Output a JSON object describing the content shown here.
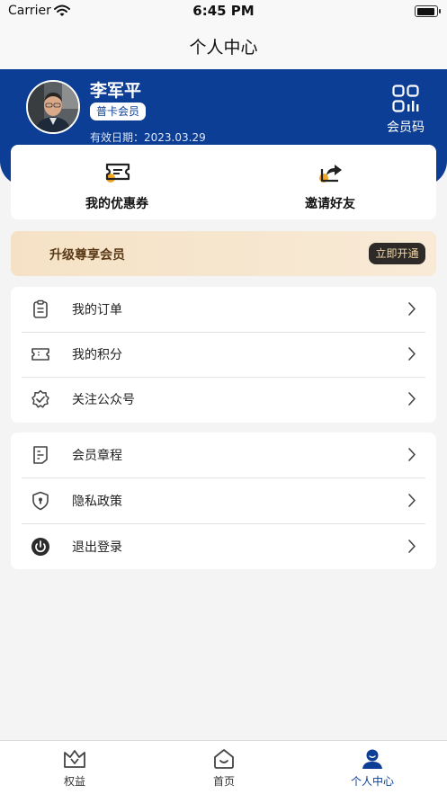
{
  "status_bar": {
    "carrier": "Carrier",
    "time": "6:45 PM"
  },
  "nav": {
    "title": "个人中心"
  },
  "profile": {
    "name": "李军平",
    "level": "普卡会员",
    "expiry_label": "有效日期：",
    "expiry_date": "2023.03.29",
    "qr_label": "会员码"
  },
  "actions": [
    {
      "label": "我的优惠券",
      "icon": "coupon-icon"
    },
    {
      "label": "邀请好友",
      "icon": "share-icon"
    }
  ],
  "vip_banner": {
    "title": "升级尊享会员",
    "button": "立即开通"
  },
  "menu_group_1": [
    {
      "label": "我的订单",
      "icon": "clipboard-icon"
    },
    {
      "label": "我的积分",
      "icon": "ticket-icon"
    },
    {
      "label": "关注公众号",
      "icon": "badge-check-icon"
    }
  ],
  "menu_group_2": [
    {
      "label": "会员章程",
      "icon": "document-icon"
    },
    {
      "label": "隐私政策",
      "icon": "shield-icon"
    },
    {
      "label": "退出登录",
      "icon": "power-icon"
    }
  ],
  "tabs": [
    {
      "label": "权益",
      "icon": "crown-icon",
      "active": false
    },
    {
      "label": "首页",
      "icon": "home-icon",
      "active": false
    },
    {
      "label": "个人中心",
      "icon": "user-icon",
      "active": true
    }
  ],
  "colors": {
    "primary": "#0b3e94",
    "accent_orange": "#f5a623",
    "vip_text": "#5b3a17"
  }
}
